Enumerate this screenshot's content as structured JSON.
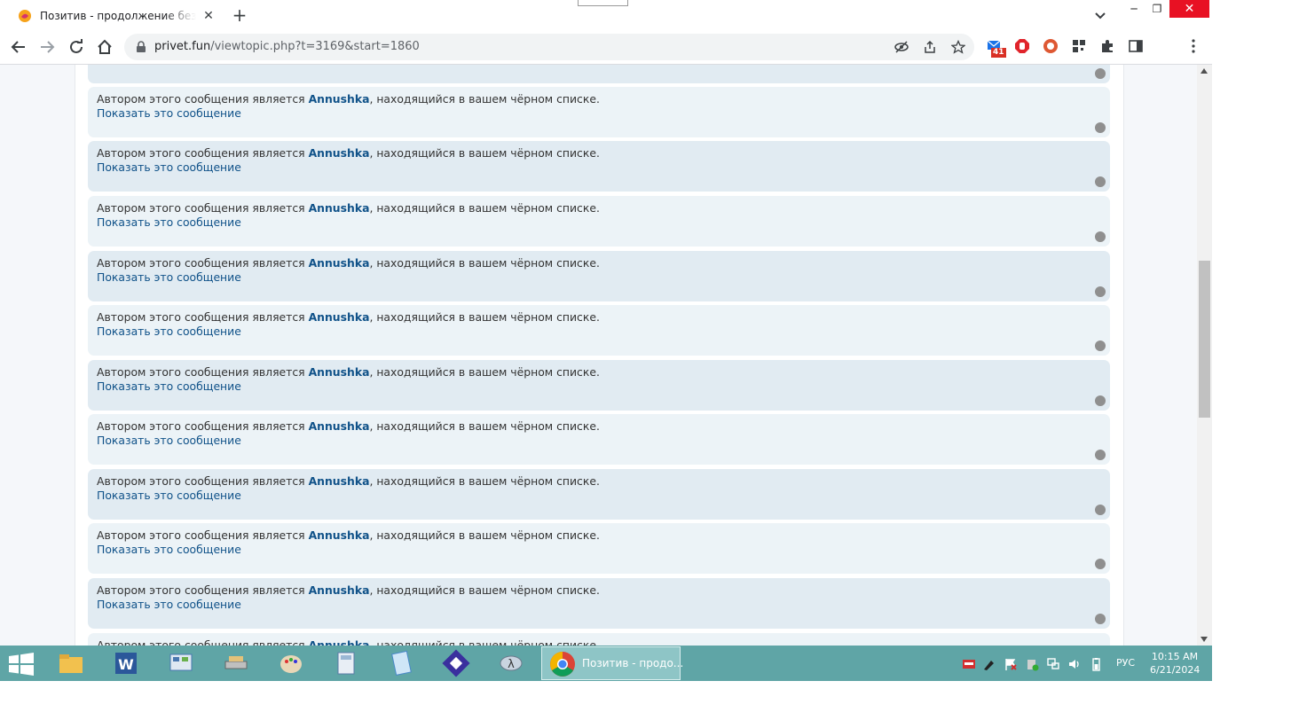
{
  "browser": {
    "tab_title": "Позитив - продолжение без тр",
    "tab_close": "✕",
    "new_tab": "+",
    "url_host": "privet.fun",
    "url_path": "/viewtopic.php?t=3169&start=1860",
    "window_controls": {
      "minimize": "─",
      "restore": "❐",
      "close": "✕"
    },
    "extension_badge": "41"
  },
  "posts": {
    "message_prefix": "Автором этого сообщения является ",
    "author": "Annushka",
    "message_suffix": ", находящийся в вашем чёрном списке.",
    "show_link": "Показать это сообщение"
  },
  "colors": {
    "post_bg_primary": "#e1ebf2",
    "post_bg_secondary": "#ecf3f7",
    "link": "#105289",
    "taskbar": "#5fa5a6"
  },
  "taskbar": {
    "active_window_label": "Позитив - продо...",
    "language": "РУС",
    "time": "10:15 AM",
    "date": "6/21/2024",
    "pinned_icons": [
      "file-explorer-icon",
      "word-icon",
      "control-panel-icon",
      "network-drive-icon",
      "paint-icon",
      "calculator-icon",
      "notepad-icon",
      "remote-desktop-icon",
      "lambda-app-icon"
    ]
  }
}
